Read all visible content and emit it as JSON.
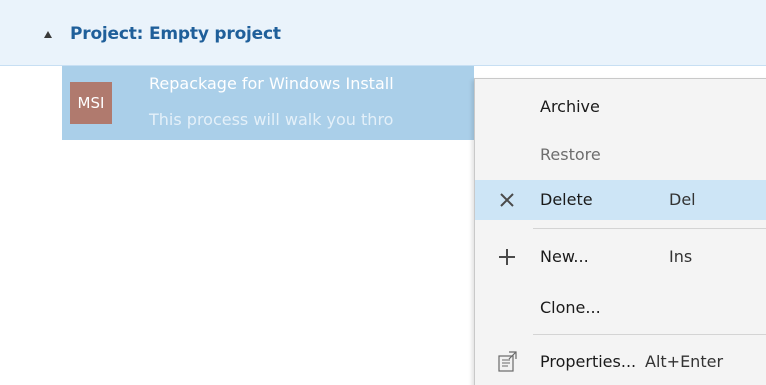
{
  "project": {
    "title": "Project: Empty project"
  },
  "selected_item": {
    "badge": "MSI",
    "title": "Repackage for Windows Install",
    "subtitle": "This process will walk you thro"
  },
  "context_menu": {
    "archive": {
      "label": "Archive"
    },
    "restore": {
      "label": "Restore"
    },
    "delete": {
      "label": "Delete",
      "shortcut": "Del",
      "icon": "close-icon"
    },
    "new": {
      "label": "New...",
      "shortcut": "Ins",
      "icon": "plus-icon"
    },
    "clone": {
      "label": "Clone..."
    },
    "properties": {
      "label": "Properties...",
      "shortcut": "Alt+Enter",
      "icon": "properties-icon"
    }
  },
  "colors": {
    "header_bg": "#eaf3fb",
    "project_title": "#1f5f9a",
    "selection": "#aacfe9",
    "msi_tile": "#b07a6e",
    "menu_bg": "#f4f4f4",
    "menu_highlight": "#cde5f6"
  }
}
